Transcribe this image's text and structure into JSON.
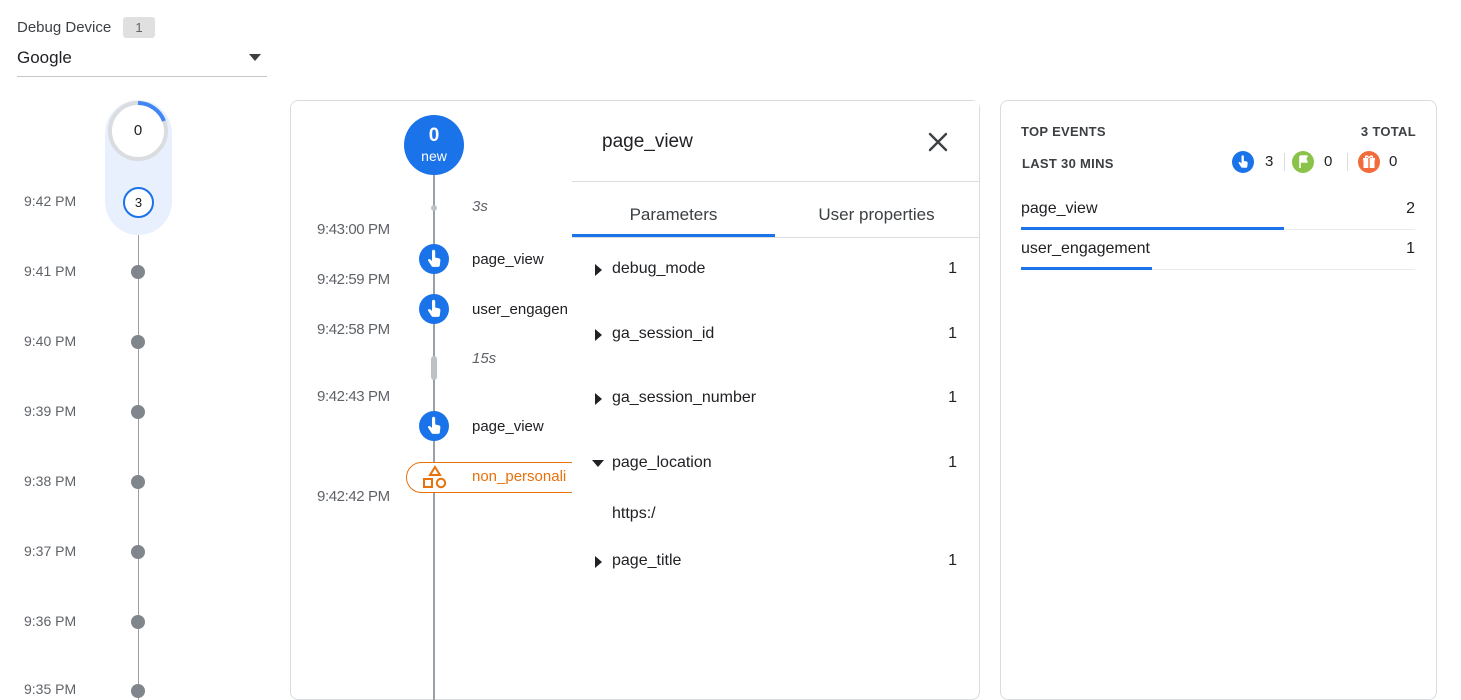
{
  "debug_device": {
    "label": "Debug Device",
    "count": "1",
    "selected": "Google"
  },
  "minutes_stream": {
    "seconds_counter": "0",
    "current_minute": {
      "time": "9:42 PM",
      "count": "3"
    },
    "minutes": [
      "9:41 PM",
      "9:40 PM",
      "9:39 PM",
      "9:38 PM",
      "9:37 PM",
      "9:36 PM",
      "9:35 PM"
    ]
  },
  "seconds_stream": {
    "new_count": "0",
    "new_label": "new",
    "gaps": [
      "3s",
      "15s"
    ],
    "timestamps": [
      "9:43:00 PM",
      "9:42:59 PM",
      "9:42:58 PM",
      "9:42:43 PM",
      "9:42:42 PM"
    ],
    "events": [
      {
        "name": "page_view",
        "icon": "pointer-icon"
      },
      {
        "name": "user_engagen",
        "icon": "pointer-icon"
      },
      {
        "name": "page_view",
        "icon": "pointer-icon"
      },
      {
        "name": "non_personali",
        "icon": "shapes-icon"
      }
    ],
    "colors": {
      "event_blue": "#1a73e8",
      "conversion_orange": "#e8710a"
    }
  },
  "event_detail": {
    "title": "page_view",
    "tabs": [
      "Parameters",
      "User properties"
    ],
    "active_tab": "Parameters",
    "parameters": [
      {
        "name": "debug_mode",
        "count": "1",
        "expanded": false
      },
      {
        "name": "ga_session_id",
        "count": "1",
        "expanded": false
      },
      {
        "name": "ga_session_number",
        "count": "1",
        "expanded": false
      },
      {
        "name": "page_location",
        "count": "1",
        "expanded": true
      },
      {
        "name": "page_title",
        "count": "1",
        "expanded": false
      }
    ],
    "expanded_value": "https:/"
  },
  "top_events": {
    "title": "TOP EVENTS",
    "total": "3 TOTAL",
    "period": "LAST 30 MINS",
    "type_counts": [
      {
        "icon": "pointer-icon",
        "color": "#1a73e8",
        "count": "3"
      },
      {
        "icon": "flag-icon",
        "color": "#8bc34a",
        "count": "0"
      },
      {
        "icon": "gift-icon",
        "color": "#f26b3a",
        "count": "0"
      }
    ],
    "rows": [
      {
        "name": "page_view",
        "count": "2",
        "share": 0.667
      },
      {
        "name": "user_engagement",
        "count": "1",
        "share": 0.333
      }
    ]
  }
}
